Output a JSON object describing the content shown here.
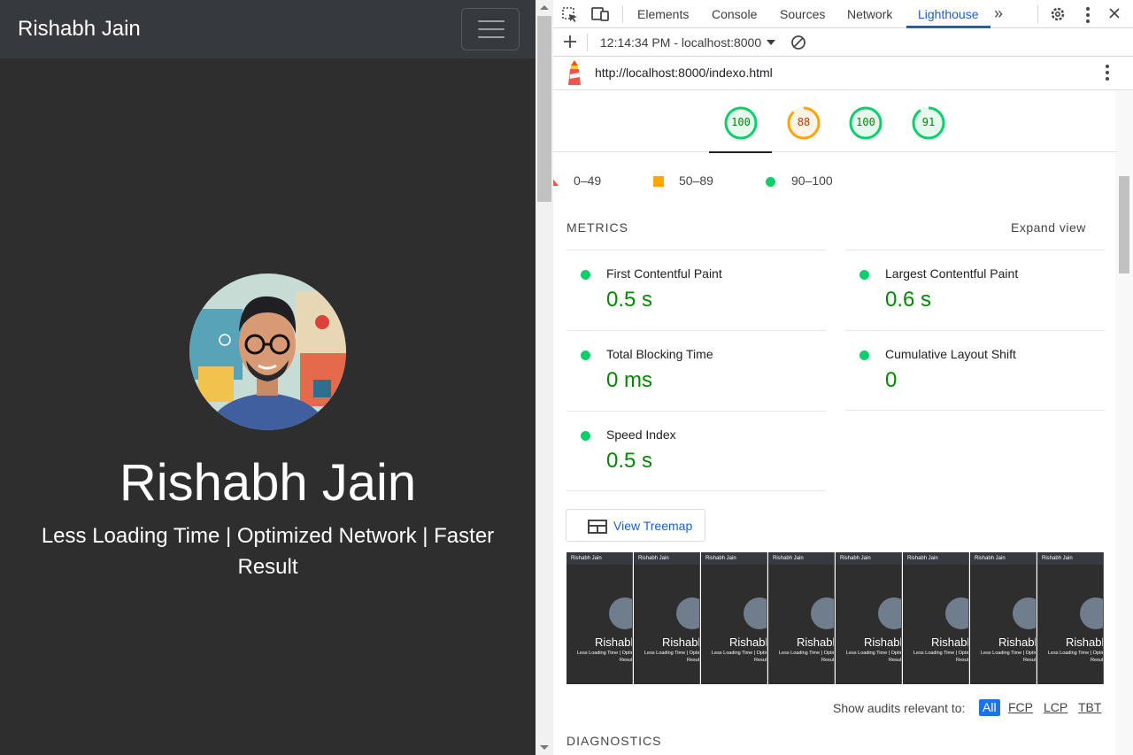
{
  "page": {
    "navbar": {
      "brand": "Rishabh Jain"
    },
    "hero": {
      "name": "Rishabh Jain",
      "tagline_line1": "Less Loading Time | Optimized Network | Faster",
      "tagline_line2": "Result"
    }
  },
  "devtools": {
    "tabs": [
      "Elements",
      "Console",
      "Sources",
      "Network",
      "Lighthouse"
    ],
    "active_tab": "Lighthouse",
    "icons": {
      "inspect": "inspect-element-icon",
      "device": "device-toolbar-icon",
      "more_tabs": "chevron-double-right-icon",
      "settings": "gear-icon",
      "menu": "kebab-menu-icon",
      "close": "close-icon"
    },
    "toolbar": {
      "report_time": "12:14:34 PM - localhost:8000"
    },
    "report": {
      "url": "http://localhost:8000/indexo.html",
      "scores": [
        {
          "value": 100,
          "color": "#0cce6b",
          "text_color": "#008800",
          "bg": "#e6f9ee"
        },
        {
          "value": 88,
          "color": "#ffa400",
          "text_color": "#c33300",
          "bg": "#fff4e5"
        },
        {
          "value": 100,
          "color": "#0cce6b",
          "text_color": "#008800",
          "bg": "#e6f9ee"
        },
        {
          "value": 91,
          "color": "#0cce6b",
          "text_color": "#008800",
          "bg": "#e6f9ee"
        }
      ],
      "legend": {
        "fail": "0–49",
        "average": "50–89",
        "pass": "90–100"
      },
      "metrics_title": "METRICS",
      "expand_label": "Expand view",
      "metrics": [
        {
          "name": "First Contentful Paint",
          "value": "0.5 s"
        },
        {
          "name": "Largest Contentful Paint",
          "value": "0.6 s"
        },
        {
          "name": "Total Blocking Time",
          "value": "0 ms"
        },
        {
          "name": "Cumulative Layout Shift",
          "value": "0"
        },
        {
          "name": "Speed Index",
          "value": "0.5 s"
        }
      ],
      "treemap_label": "View Treemap",
      "filmstrip_frame": {
        "brand": "Rishabh Jain",
        "name": "Rishabh",
        "tag": "Less Loading Time | Optimiz",
        "result": "Result"
      },
      "audits_filter": {
        "label": "Show audits relevant to:",
        "chips": [
          "All",
          "FCP",
          "LCP",
          "TBT"
        ]
      },
      "diagnostics_title": "DIAGNOSTICS"
    }
  }
}
